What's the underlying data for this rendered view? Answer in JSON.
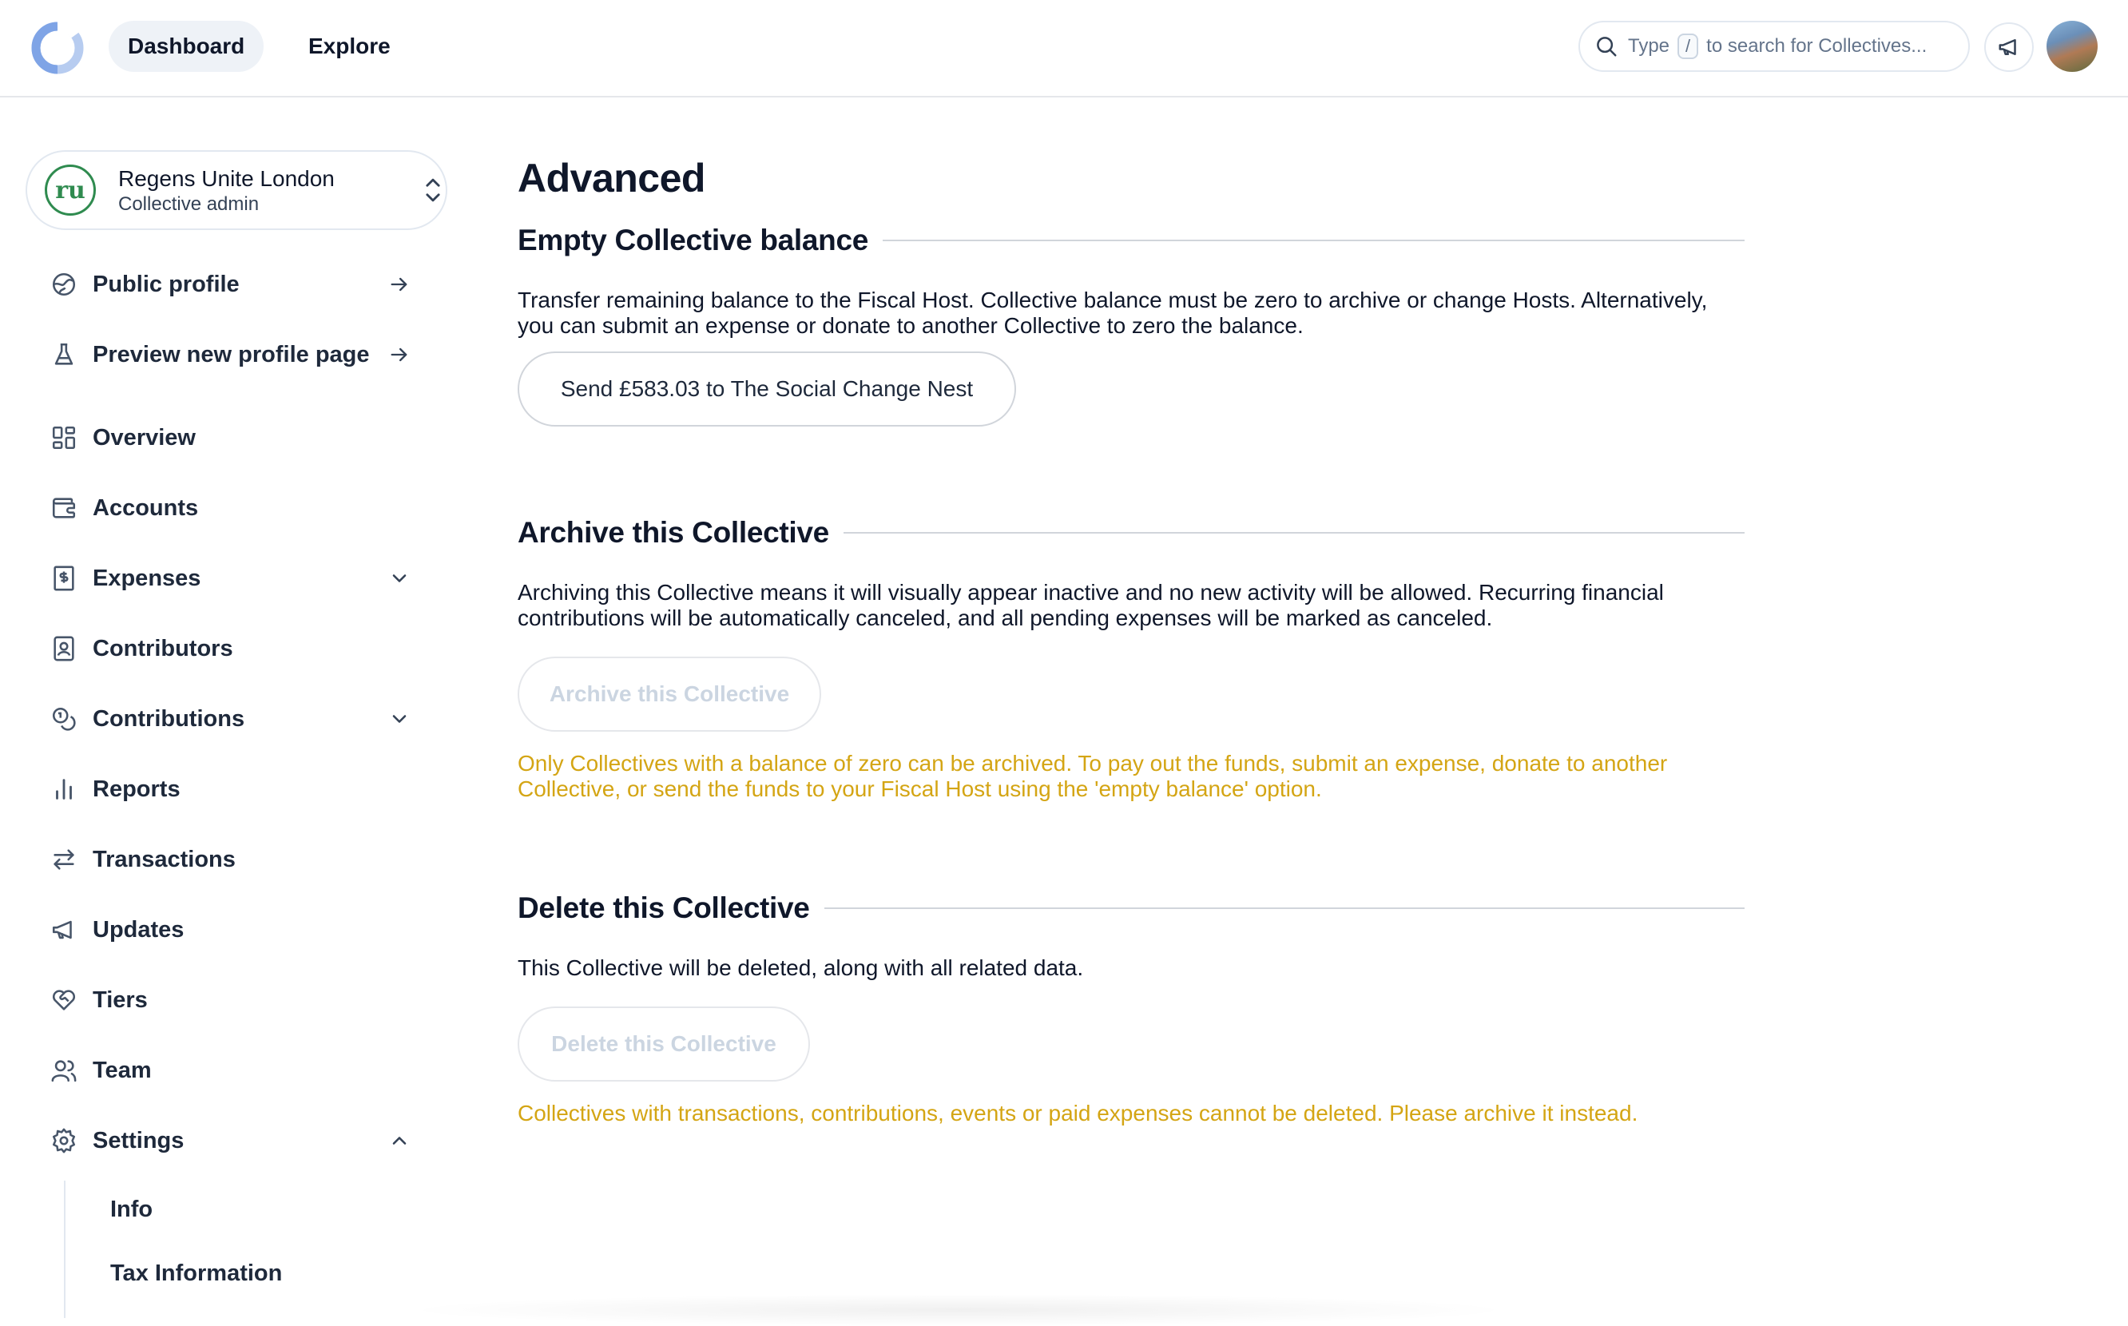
{
  "topbar": {
    "nav": [
      {
        "label": "Dashboard",
        "active": true
      },
      {
        "label": "Explore",
        "active": false
      }
    ],
    "search": {
      "prefix": "Type",
      "key": "/",
      "suffix": "to search for Collectives..."
    }
  },
  "account": {
    "name": "Regens Unite London",
    "role": "Collective admin",
    "logo_text": "ru"
  },
  "sidebar": {
    "items": [
      {
        "label": "Public profile",
        "icon": "globe-icon",
        "trail": "arrow-right-icon"
      },
      {
        "label": "Preview new profile page",
        "icon": "flask-icon",
        "trail": "arrow-right-icon"
      },
      {
        "label": "Overview",
        "icon": "dashboard-icon"
      },
      {
        "label": "Accounts",
        "icon": "wallet-icon"
      },
      {
        "label": "Expenses",
        "icon": "receipt-icon",
        "trail": "chevron-down-icon"
      },
      {
        "label": "Contributors",
        "icon": "contact-icon"
      },
      {
        "label": "Contributions",
        "icon": "coins-icon",
        "trail": "chevron-down-icon"
      },
      {
        "label": "Reports",
        "icon": "bar-chart-icon"
      },
      {
        "label": "Transactions",
        "icon": "arrows-exchange-icon"
      },
      {
        "label": "Updates",
        "icon": "megaphone-icon"
      },
      {
        "label": "Tiers",
        "icon": "heart-handshake-icon"
      },
      {
        "label": "Team",
        "icon": "users-icon"
      },
      {
        "label": "Settings",
        "icon": "gear-icon",
        "trail": "chevron-up-icon"
      }
    ],
    "settings_sub": [
      "Info",
      "Tax Information"
    ]
  },
  "main": {
    "title": "Advanced",
    "sections": [
      {
        "heading": "Empty Collective balance",
        "text": "Transfer remaining balance to the Fiscal Host. Collective balance must be zero to archive or change Hosts. Alternatively, you can submit an expense or donate to another Collective to zero the balance.",
        "button": "Send £583.03 to The Social Change Nest"
      },
      {
        "heading": "Archive this Collective",
        "text": "Archiving this Collective means it will visually appear inactive and no new activity will be allowed. Recurring financial contributions will be automatically canceled, and all pending expenses will be marked as canceled.",
        "button": "Archive this Collective",
        "warning": "Only Collectives with a balance of zero can be archived. To pay out the funds, submit an expense, donate to another Collective, or send the funds to your Fiscal Host using the 'empty balance' option."
      },
      {
        "heading": "Delete this Collective",
        "text": "This Collective will be deleted, along with all related data.",
        "button": "Delete this Collective",
        "warning": "Collectives with transactions, contributions, events or paid expenses cannot be deleted. Please archive it instead."
      }
    ]
  },
  "colors": {
    "accent_warning": "#d4a514",
    "brand_green": "#2f8b4f"
  }
}
